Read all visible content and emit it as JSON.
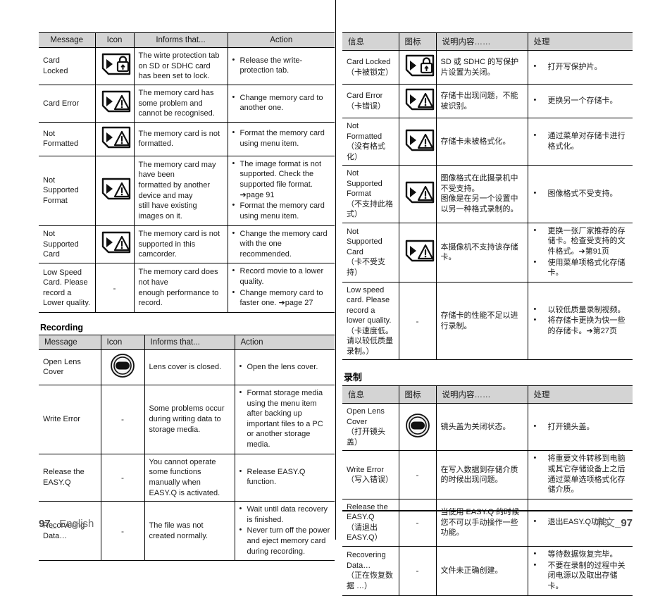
{
  "page": {
    "footer_en_number": "97",
    "footer_en_label": "English",
    "footer_zh_label": "中文",
    "footer_zh_number": "97"
  },
  "english": {
    "table1": {
      "headers": [
        "Message",
        "Icon",
        "Informs that...",
        "Action"
      ],
      "rows": [
        {
          "message": "Card\nLocked",
          "icon": "card-lock-icon",
          "informs": "The wirte protection tab on SD or SDHC card has been set to lock.",
          "actions": [
            "Release the write-protection tab."
          ]
        },
        {
          "message": "Card Error",
          "icon": "card-warning-icon",
          "informs": "The memory card has some problem and cannot be recognised.",
          "actions": [
            "Change memory card to another one."
          ]
        },
        {
          "message": "Not\nFormatted",
          "icon": "card-warning-icon",
          "informs": "The memory card is not formatted.",
          "actions": [
            "Format the memory card using menu item."
          ]
        },
        {
          "message": "Not\nSupported\nFormat",
          "icon": "card-warning-icon",
          "informs": "The memory card may have been\nformatted by another device and may\nstill have existing images on it.",
          "actions": [
            "The image format is not supported. Check the supported file format. ➔page 91",
            "Format the memory card using menu item."
          ]
        },
        {
          "message": "Not\nSupported\nCard",
          "icon": "card-warning-icon",
          "informs": "The memory card is not supported in this camcorder.",
          "actions": [
            "Change the memory card with the one recommended."
          ]
        },
        {
          "message": "Low Speed Card. Please record a Lower quality.",
          "icon": "-",
          "informs": "The memory card does not have\nenough performance to record.",
          "actions": [
            "Record movie to a lower quality.",
            "Change memory card to faster one. ➔page 27"
          ]
        }
      ]
    },
    "section2_title": "Recording",
    "table2": {
      "headers": [
        "Message",
        "Icon",
        "Informs that...",
        "Action"
      ],
      "rows": [
        {
          "message": "Open Lens\nCover",
          "icon": "lens-cover-icon",
          "informs": "Lens cover is closed.",
          "actions": [
            "Open the lens cover."
          ]
        },
        {
          "message": "Write Error",
          "icon": "-",
          "informs": "Some problems occur during writing data to storage media.",
          "actions": [
            "Format storage media using the menu item after backing up important files to a PC or another storage media."
          ]
        },
        {
          "message": "Release the\nEASY.Q",
          "icon": "-",
          "informs": "You cannot operate some functions manually when EASY.Q is activated.",
          "actions": [
            "Release EASY.Q function."
          ]
        },
        {
          "message": "Recorvering\nData…",
          "icon": "-",
          "informs": "The file was not created normally.",
          "actions": [
            "Wait until data recovery is finished.",
            "Never turn off the power and eject memory card during recording."
          ]
        }
      ]
    }
  },
  "chinese": {
    "table1": {
      "headers": [
        "信息",
        "图标",
        "说明内容……",
        "处理"
      ],
      "rows": [
        {
          "message": "Card Locked\n（卡被锁定）",
          "icon": "card-lock-icon",
          "informs": "SD 或 SDHC 的写保护片设置为关闭。",
          "actions": [
            "打开写保护片。"
          ]
        },
        {
          "message": "Card Error\n（卡错误）",
          "icon": "card-warning-icon",
          "informs": "存储卡出现问题，不能被识别。",
          "actions": [
            "更换另一个存储卡。"
          ]
        },
        {
          "message": "Not Formatted\n（没有格式化）",
          "icon": "card-warning-icon",
          "informs": "存储卡未被格式化。",
          "actions": [
            "通过菜单对存储卡进行格式化。"
          ]
        },
        {
          "message": "Not\nSupported\nFormat\n（不支持此格式）",
          "icon": "card-warning-icon",
          "informs": "图像格式在此摄录机中不受支持。\n图像是在另一个设置中以另一种格式录制的。",
          "actions": [
            "图像格式不受支持。"
          ]
        },
        {
          "message": "Not\nSupported\nCard\n（卡不受支持）",
          "icon": "card-warning-icon",
          "informs": "本摄像机不支持该存储卡。",
          "actions": [
            "更换一张厂家推荐的存储卡。检查受支持的文件格式。➔第91页",
            "使用菜单项格式化存储卡。"
          ]
        },
        {
          "message": "Low speed card. Please record a lower quality.\n（卡速度低。请以较低质量录制。）",
          "icon": "-",
          "informs": "存储卡的性能不足以进行录制。",
          "actions": [
            "以较低质量录制视频。",
            "将存储卡更换为快一些的存储卡。➔第27页"
          ]
        }
      ]
    },
    "section2_title": "录制",
    "table2": {
      "headers": [
        "信息",
        "图标",
        "说明内容……",
        "处理"
      ],
      "rows": [
        {
          "message": "Open Lens\nCover\n（打开镜头盖）",
          "icon": "lens-cover-icon",
          "informs": "镜头盖为关闭状态。",
          "actions": [
            "打开镜头盖。"
          ]
        },
        {
          "message": "Write Error\n（写入错误）",
          "icon": "-",
          "informs": "在写入数据到存储介质的时候出现问题。",
          "actions": [
            "将重要文件转移到电脑或其它存储设备上之后通过菜单选项格式化存储介质。"
          ]
        },
        {
          "message": "Release the\nEASY.Q\n（请退出EASY.Q）",
          "icon": "-",
          "informs": "当使用 EASY.Q 的时候您不可以手动操作一些功能。",
          "actions": [
            "退出EASY.Q功能。"
          ]
        },
        {
          "message": "Recovering\nData…\n（正在恢复数据 …）",
          "icon": "-",
          "informs": "文件未正确创建。",
          "actions": [
            "等待数据恢复完毕。",
            "不要在录制的过程中关闭电源以及取出存储卡。"
          ]
        }
      ]
    }
  }
}
